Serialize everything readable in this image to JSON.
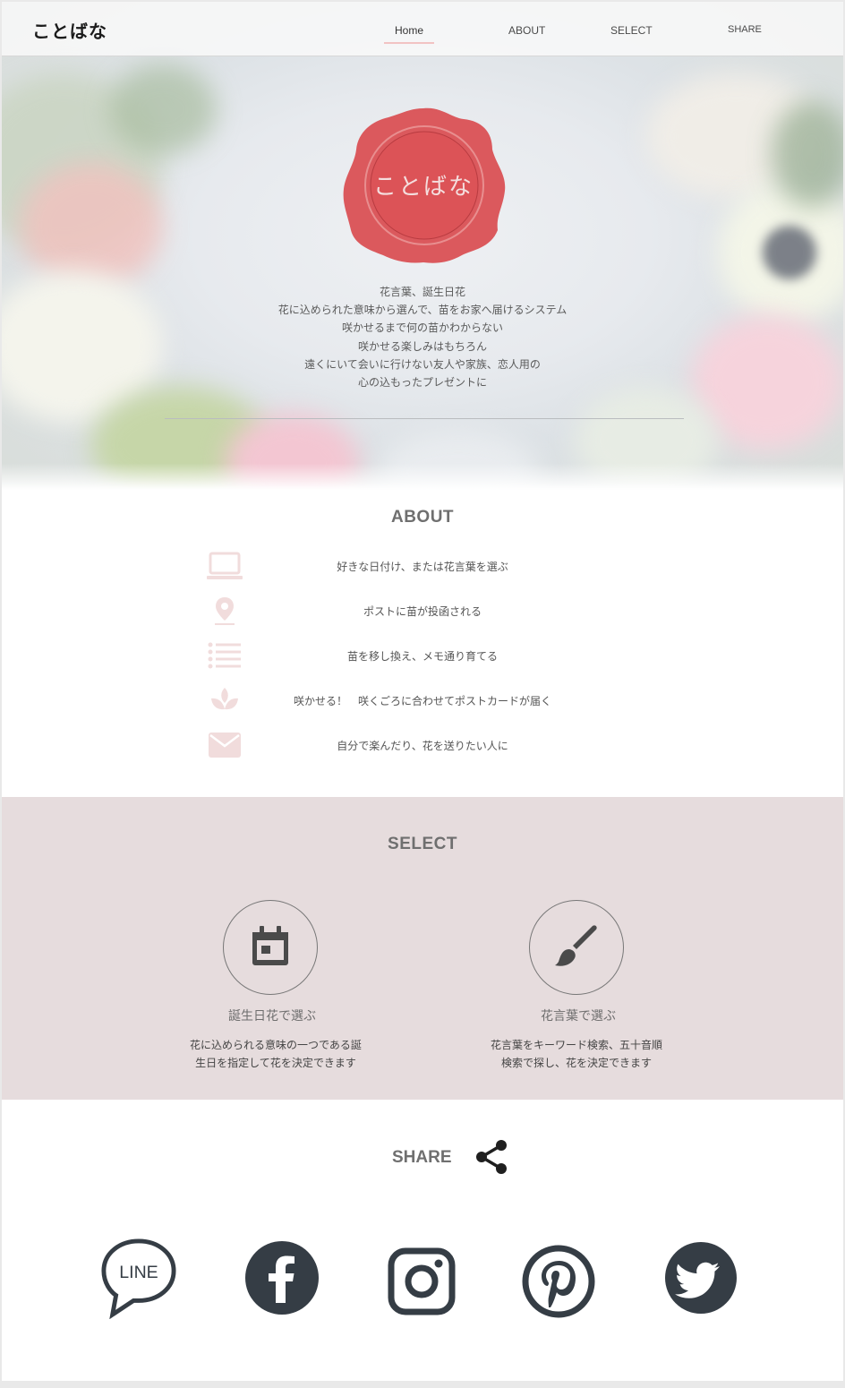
{
  "nav": {
    "logo": "ことばな",
    "items": [
      "Home",
      "ABOUT",
      "SELECT",
      "SHARE"
    ]
  },
  "hero": {
    "seal_text": "ことばな",
    "intro_lines": [
      "花言葉、誕生日花",
      "花に込められた意味から選んで、苗をお家へ届けるシステム",
      "咲かせるまで何の苗かわからない",
      "咲かせる楽しみはもちろん",
      "遠くにいて会いに行けない友人や家族、恋人用の",
      "心の込もったプレゼントに"
    ]
  },
  "about": {
    "title": "ABOUT",
    "steps": [
      {
        "icon": "laptop-icon",
        "text": "好きな日付け、または花言葉を選ぶ"
      },
      {
        "icon": "map-pin-icon",
        "text": "ポストに苗が投函される"
      },
      {
        "icon": "list-icon",
        "text": "苗を移し換え、メモ通り育てる"
      },
      {
        "icon": "lotus-icon",
        "text": "咲かせる！　咲くごろに合わせてポストカードが届く"
      },
      {
        "icon": "mail-icon",
        "text": "自分で楽んだり、花を送りたい人に"
      }
    ]
  },
  "select": {
    "title": "SELECT",
    "options": [
      {
        "icon": "calendar-icon",
        "label": "誕生日花で選ぶ",
        "desc_lines": [
          "花に込められる意味の一つである誕",
          "生日を指定して花を決定できます"
        ]
      },
      {
        "icon": "brush-icon",
        "label": "花言葉で選ぶ",
        "desc_lines": [
          "花言葉をキーワード検索、五十音順",
          "検索で探し、花を決定できます"
        ]
      }
    ]
  },
  "share": {
    "title": "SHARE",
    "line_label": "LINE",
    "networks": [
      "line-icon",
      "facebook-icon",
      "instagram-icon",
      "pinterest-icon",
      "twitter-icon"
    ]
  },
  "colors": {
    "seal_red": "#d94c50",
    "select_bg": "#e6dcdd",
    "icon_pink": "#f1dcdc",
    "social_dark": "#353d45"
  }
}
